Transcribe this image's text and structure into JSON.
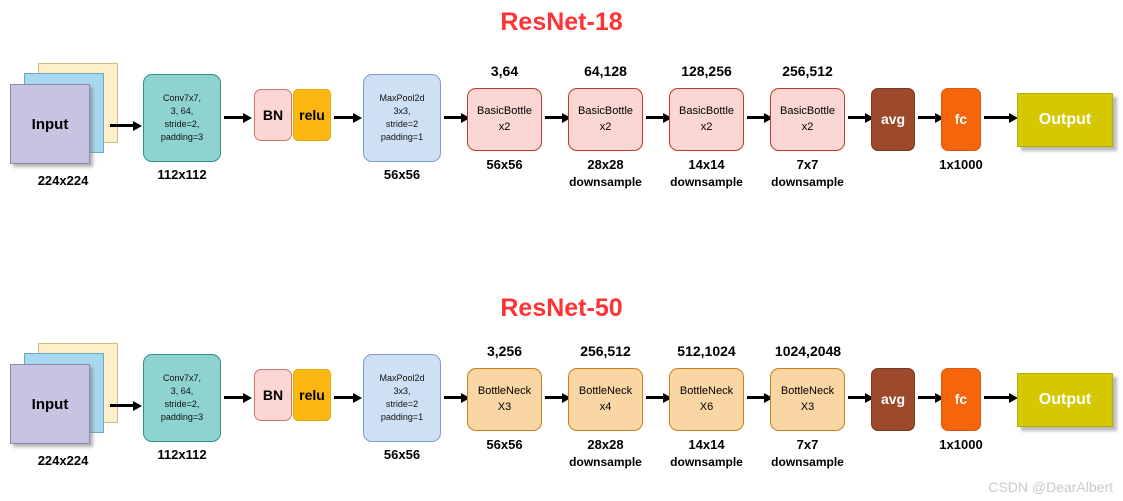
{
  "watermark": "CSDN @DearAlbert",
  "diagrams": [
    {
      "id": "resnet18",
      "title": "ResNet-18",
      "title_color": "#ff3333",
      "input": {
        "label": "Input",
        "caption": "224x224",
        "sheet_colors": [
          "#fdf0c8",
          "#a8d8ef",
          "#c6c4e0"
        ]
      },
      "conv": {
        "lines": [
          "Conv7x7,",
          "3,  64,",
          "stride=2,",
          "padding=3"
        ],
        "caption": "112x112",
        "color": "#8fd3d0"
      },
      "bn": {
        "label": "BN",
        "color": "#fbd7d4"
      },
      "relu": {
        "label": "relu",
        "color": "#fcb712"
      },
      "maxpool": {
        "lines": [
          "MaxPool2d",
          "3x3,",
          "stride=2",
          "padding=1"
        ],
        "caption": "56x56",
        "color": "#cfe0f5"
      },
      "blocks": [
        {
          "top": "3,64",
          "name": "BasicBottle",
          "repeat": "x2",
          "size": "56x56",
          "sub": ""
        },
        {
          "top": "64,128",
          "name": "BasicBottle",
          "repeat": "x2",
          "size": "28x28",
          "sub": "downsample"
        },
        {
          "top": "128,256",
          "name": "BasicBottle",
          "repeat": "x2",
          "size": "14x14",
          "sub": "downsample"
        },
        {
          "top": "256,512",
          "name": "BasicBottle",
          "repeat": "x2",
          "size": "7x7",
          "sub": "downsample"
        }
      ],
      "block_color": "#fbd7d4",
      "avg": {
        "label": "avg",
        "color": "#9c4a2b"
      },
      "fc": {
        "label": "fc",
        "caption": "1x1000",
        "color": "#f4650c"
      },
      "output": {
        "label": "Output",
        "color": "#d6c800"
      }
    },
    {
      "id": "resnet50",
      "title": "ResNet-50",
      "title_color": "#ff3333",
      "input": {
        "label": "Input",
        "caption": "224x224",
        "sheet_colors": [
          "#fdf0c8",
          "#a8d8ef",
          "#c6c4e0"
        ]
      },
      "conv": {
        "lines": [
          "Conv7x7,",
          "3,  64,",
          "stride=2,",
          "padding=3"
        ],
        "caption": "112x112",
        "color": "#8fd3d0"
      },
      "bn": {
        "label": "BN",
        "color": "#fbd7d4"
      },
      "relu": {
        "label": "relu",
        "color": "#fcb712"
      },
      "maxpool": {
        "lines": [
          "MaxPool2d",
          "3x3,",
          "stride=2",
          "padding=1"
        ],
        "caption": "56x56",
        "color": "#cfe0f5"
      },
      "blocks": [
        {
          "top": "3,256",
          "name": "BottleNeck",
          "repeat": "X3",
          "size": "56x56",
          "sub": ""
        },
        {
          "top": "256,512",
          "name": "BottleNeck",
          "repeat": "x4",
          "size": "28x28",
          "sub": "downsample"
        },
        {
          "top": "512,1024",
          "name": "BottleNeck",
          "repeat": "X6",
          "size": "14x14",
          "sub": "downsample"
        },
        {
          "top": "1024,2048",
          "name": "BottleNeck",
          "repeat": "X3",
          "size": "7x7",
          "sub": "downsample"
        }
      ],
      "block_color": "#fad6a5",
      "avg": {
        "label": "avg",
        "color": "#9c4a2b"
      },
      "fc": {
        "label": "fc",
        "caption": "1x1000",
        "color": "#f4650c"
      },
      "output": {
        "label": "Output",
        "color": "#d6c800"
      }
    }
  ]
}
